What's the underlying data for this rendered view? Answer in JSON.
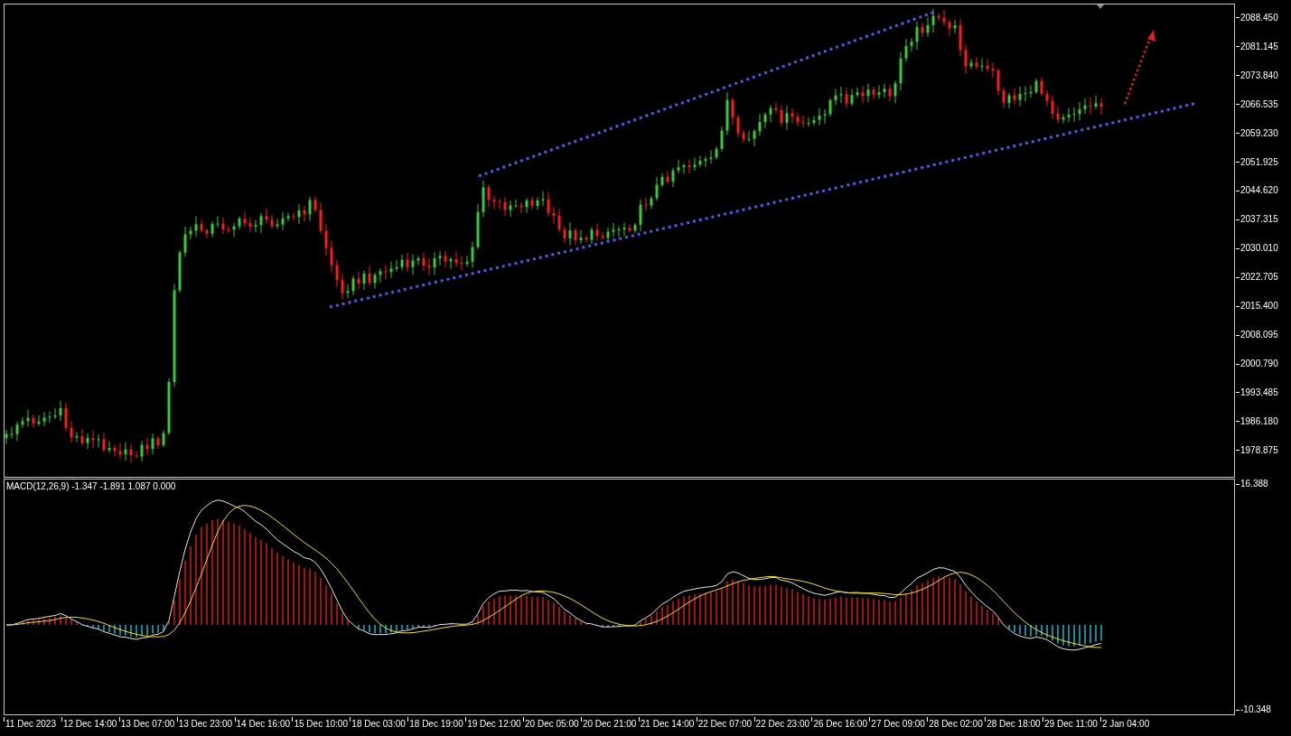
{
  "price_axis": {
    "labels": [
      "2088.450",
      "2081.145",
      "2073.840",
      "2066.535",
      "2059.230",
      "2051.925",
      "2044.620",
      "2037.315",
      "2030.010",
      "2022.705",
      "2015.400",
      "2008.095",
      "2000.790",
      "1993.485",
      "1986.180",
      "1978.875"
    ]
  },
  "indicator": {
    "label": "MACD(12,26,9) -1.347 -1.891 1.087 0.000",
    "axis_labels": [
      "16.388",
      "-10.348"
    ]
  },
  "time_axis": {
    "labels": [
      "11 Dec 2023",
      "12 Dec 14:00",
      "13 Dec 07:00",
      "13 Dec 23:00",
      "14 Dec 16:00",
      "15 Dec 10:00",
      "18 Dec 03:00",
      "18 Dec 19:00",
      "19 Dec 12:00",
      "20 Dec 05:00",
      "20 Dec 21:00",
      "21 Dec 14:00",
      "22 Dec 07:00",
      "22 Dec 23:00",
      "26 Dec 16:00",
      "27 Dec 09:00",
      "28 Dec 02:00",
      "28 Dec 18:00",
      "29 Dec 11:00",
      "2 Jan 04:00"
    ]
  }
}
